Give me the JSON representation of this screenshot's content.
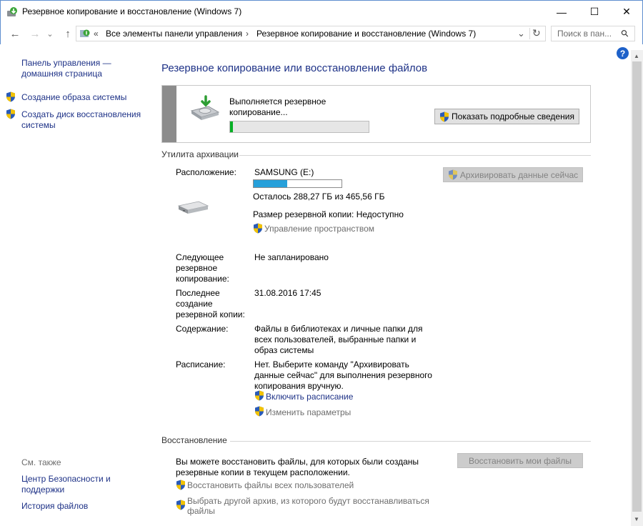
{
  "window": {
    "title": "Резервное копирование и восстановление (Windows 7)",
    "minimize": "—",
    "maximize": "☐",
    "close": "✕"
  },
  "nav": {
    "back": "←",
    "forward": "→",
    "recent": "⌄",
    "up": "↑",
    "overflow": "«",
    "breadcrumb": [
      "Все элементы панели управления",
      "Резервное копирование и восстановление (Windows 7)"
    ],
    "sep": "›",
    "dropdown": "⌄",
    "refresh": "↻",
    "search_placeholder": "Поиск в пан...",
    "search_icon": "⚲"
  },
  "help": "?",
  "sidebar": {
    "home": "Панель управления — домашняя страница",
    "items": [
      "Создание образа системы",
      "Создать диск восстановления системы"
    ],
    "see_also": "См. также",
    "see_also_items": [
      "Центр Безопасности и поддержки",
      "История файлов"
    ]
  },
  "main": {
    "heading": "Резервное копирование или восстановление файлов",
    "status": "Выполняется резервное копирование...",
    "progress": 0.02,
    "details_button": "Показать подробные сведения",
    "backup_section": "Утилита архивации",
    "backup_now": "Архивировать данные сейчас",
    "location_label": "Расположение:",
    "drive_name": "SAMSUNG (E:)",
    "drive_used_fraction": 0.38,
    "free_space": "Осталось 288,27 ГБ из 465,56 ГБ",
    "backup_size": "Размер резервной копии: Недоступно",
    "manage_space": "Управление пространством",
    "next_label": "Следующее резервное копирование:",
    "next_value": "Не запланировано",
    "last_label": "Последнее создание резервной копии:",
    "last_value": "31.08.2016 17:45",
    "contents_label": "Содержание:",
    "contents_value": "Файлы в библиотеках и личные папки для всех пользователей, выбранные папки и образ системы",
    "schedule_label": "Расписание:",
    "schedule_value": "Нет. Выберите команду \"Архивировать данные сейчас\" для выполнения резервного копирования вручную.",
    "enable_schedule": "Включить расписание",
    "change_settings": "Изменить параметры",
    "restore_section": "Восстановление",
    "restore_text": "Вы можете восстановить файлы, для которых были созданы резервные копии в текущем расположении.",
    "restore_button": "Восстановить мои файлы",
    "restore_all": "Восстановить файлы всех пользователей",
    "select_other": "Выбрать другой архив, из которого будут восстанавливаться файлы"
  },
  "colors": {
    "accent": "#1e3287",
    "progress": "#06b025",
    "capacity": "#26a0da",
    "disabled_btn": "#cccccc"
  }
}
